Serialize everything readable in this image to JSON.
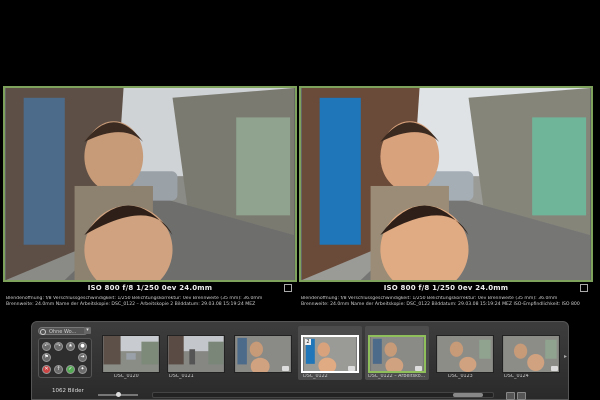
{
  "viewer": {
    "left_exif": "ISO 800   f/8   1/250   0ev   24.0mm",
    "right_exif": "ISO 800   f/8   1/250   0ev   24.0mm",
    "left_meta_line1": "Blendenöffnung: f/8  Verschlussgeschwindigkeit: 1/250  Belichtungskorrektur: 0ev  Brennweite (35 mm): 36.0mm",
    "left_meta_line2": "Brennweite: 24.0mm  Name der Arbeitskopie: DSC_0122 – Arbeitskopie 2  Bilddatum: 29.03.08 15:19:24 MEZ",
    "right_meta_line1": "Blendenöffnung: f/8  Verschlussgeschwindigkeit: 1/250  Belichtungskorrektur: 0ev  Brennweite (35 mm): 36.0mm",
    "right_meta_line2": "Brennweite: 24.0mm  Name der Arbeitskopie: DSC_0122  Bilddatum: 29.03.08 15:19:24 MEZ  ISO-Empfindlichkeit: ISO 800"
  },
  "filmstrip": {
    "search_placeholder": "Ohne Wo...",
    "search_option": "▾",
    "image_count": "1062 Bilder",
    "buttons": [
      "↶",
      "↷",
      "★",
      "●",
      "⚑",
      "✕",
      "↑",
      "✓",
      "✦",
      "➜"
    ],
    "thumbs": [
      {
        "label": "DSC_0120",
        "type": "street"
      },
      {
        "label": "DSC_0121",
        "type": "street"
      },
      {
        "label": "",
        "type": "kids"
      },
      {
        "label": "DSC_0122",
        "type": "kids"
      },
      {
        "label": "DSC_0122 – Arbeitsko...",
        "type": "kids"
      },
      {
        "label": "DSC_0123",
        "type": "kids"
      },
      {
        "label": "DSC_0124",
        "type": "kids"
      }
    ],
    "arrow": "▸"
  },
  "colors": {
    "select_green": "#8fbf5a",
    "photo_border": "#7ea25c"
  }
}
